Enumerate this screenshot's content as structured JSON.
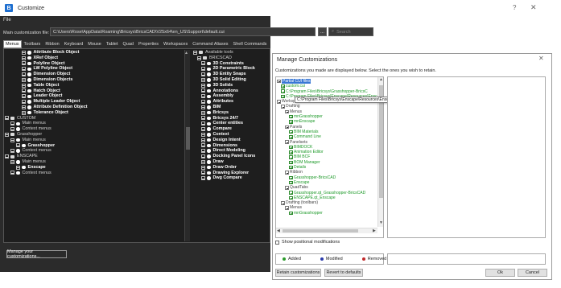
{
  "customize": {
    "title": "Customize",
    "app_icon": "bricscad-logo-icon",
    "help_label": "?",
    "close_label": "✕",
    "menubar": "File",
    "main_file_label": "Main customization file:",
    "main_file_value": "C:\\Users\\Rose\\AppData\\Roaming\\Bricsys\\BricsCAD\\V25x64\\en_US\\Support\\default.cui",
    "browse_label": "...",
    "search_placeholder": "Search",
    "tabs": [
      "Menus",
      "Toolbars",
      "Ribbon",
      "Keyboard",
      "Mouse",
      "Tablet",
      "Quad",
      "Properties",
      "Workspaces",
      "Command Aliases",
      "Shell Commands"
    ],
    "active_tab": "Menus",
    "left_tree": [
      {
        "label": "Attribute Block Object",
        "bold": true
      },
      {
        "label": "XRef Object",
        "bold": true
      },
      {
        "label": "Polyline Object",
        "bold": true
      },
      {
        "label": "LW Polyline Object",
        "bold": true
      },
      {
        "label": "Dimension Object",
        "bold": true
      },
      {
        "label": "Dimension Objects",
        "bold": true
      },
      {
        "label": "Table Object",
        "bold": true
      },
      {
        "label": "Hatch Object",
        "bold": true
      },
      {
        "label": "Leader Object",
        "bold": true
      },
      {
        "label": "Multiple Leader Object",
        "bold": true
      },
      {
        "label": "Attribute Definition Object",
        "bold": true
      },
      {
        "label": "Tolerance Object",
        "bold": true
      },
      {
        "label": "CUSTOM",
        "bold": false
      },
      {
        "label": "Main menus",
        "bold": false
      },
      {
        "label": "Context menus",
        "bold": false
      },
      {
        "label": "Grasshopper",
        "bold": false
      },
      {
        "label": "Main menus",
        "bold": false
      },
      {
        "label": "Grasshopper",
        "bold": true
      },
      {
        "label": "Context menus",
        "bold": false
      },
      {
        "label": "ENSCAPE",
        "bold": false
      },
      {
        "label": "Main menus",
        "bold": false
      },
      {
        "label": "Enscape",
        "bold": true
      },
      {
        "label": "Context menus",
        "bold": false
      }
    ],
    "right_tree": [
      {
        "label": "Available tools",
        "bold": false
      },
      {
        "label": "BRICSCAD",
        "bold": false
      },
      {
        "label": "3D Constraints",
        "bold": true
      },
      {
        "label": "2D Parametric Block",
        "bold": true
      },
      {
        "label": "3D Entity Snaps",
        "bold": true
      },
      {
        "label": "3D Solid Editing",
        "bold": true
      },
      {
        "label": "3D Solids",
        "bold": true
      },
      {
        "label": "Annotations",
        "bold": true
      },
      {
        "label": "Assembly",
        "bold": true
      },
      {
        "label": "Attributes",
        "bold": true
      },
      {
        "label": "BIM",
        "bold": true
      },
      {
        "label": "Bricsys",
        "bold": true
      },
      {
        "label": "Bricsys 24/7",
        "bold": true
      },
      {
        "label": "Center entities",
        "bold": true
      },
      {
        "label": "Compare",
        "bold": true
      },
      {
        "label": "Context",
        "bold": true
      },
      {
        "label": "Design Intent",
        "bold": true
      },
      {
        "label": "Dimensions",
        "bold": true
      },
      {
        "label": "Direct Modeling",
        "bold": true
      },
      {
        "label": "Docking Panel Icons",
        "bold": true
      },
      {
        "label": "Draw",
        "bold": true
      },
      {
        "label": "Draw Order",
        "bold": true
      },
      {
        "label": "Drawing Explorer",
        "bold": true
      },
      {
        "label": "Dwg Compare",
        "bold": true
      }
    ],
    "manage_button": "Manage your customizations..."
  },
  "dialog": {
    "title": "Manage Customizations",
    "close_label": "✕",
    "description": "Customizations you made are displayed below. Select the ones you wish to retain.",
    "tree": [
      {
        "label": "Partial CUI files",
        "indent": 0,
        "kind": "mx",
        "color": "sel"
      },
      {
        "label": "custom.cui",
        "indent": 1,
        "kind": "cb",
        "color": "green"
      },
      {
        "label": "C:\\Program Files\\Bricsys\\Grasshopper-BricsC",
        "indent": 1,
        "kind": "cb",
        "color": "green"
      },
      {
        "label": "C:\\Program Files\\Bricsys\\Enscape\\Resources\\Enscape.cui",
        "indent": 1,
        "kind": "cb",
        "color": "green"
      },
      {
        "label": "Workspaces",
        "indent": 0,
        "kind": "mx",
        "color": "dark"
      },
      {
        "label": "Drafting",
        "indent": 1,
        "kind": "mx",
        "color": "dark"
      },
      {
        "label": "Menus",
        "indent": 2,
        "kind": "mx",
        "color": "dark"
      },
      {
        "label": "mnGrasshopper",
        "indent": 3,
        "kind": "cb",
        "color": "green"
      },
      {
        "label": "mnEnscape",
        "indent": 3,
        "kind": "cb",
        "color": "green"
      },
      {
        "label": "Panels",
        "indent": 2,
        "kind": "mx",
        "color": "dark"
      },
      {
        "label": "BIM Materials",
        "indent": 3,
        "kind": "cb",
        "color": "green"
      },
      {
        "label": "Command Line",
        "indent": 3,
        "kind": "cb",
        "color": "green"
      },
      {
        "label": "Panelsets",
        "indent": 2,
        "kind": "mx",
        "color": "dark"
      },
      {
        "label": "BIMDOCK",
        "indent": 3,
        "kind": "cb",
        "color": "green"
      },
      {
        "label": "Animation Editor",
        "indent": 3,
        "kind": "cb",
        "color": "green"
      },
      {
        "label": "BIM BCF",
        "indent": 3,
        "kind": "cb",
        "color": "green"
      },
      {
        "label": "BOM Manager",
        "indent": 3,
        "kind": "cb",
        "color": "green"
      },
      {
        "label": "Details",
        "indent": 3,
        "kind": "cb",
        "color": "green"
      },
      {
        "label": "Ribbon",
        "indent": 2,
        "kind": "mx",
        "color": "dark"
      },
      {
        "label": "Grasshopper-BricsCAD",
        "indent": 3,
        "kind": "cb",
        "color": "green"
      },
      {
        "label": "Enscape",
        "indent": 3,
        "kind": "cb",
        "color": "green"
      },
      {
        "label": "QuadTabs",
        "indent": 2,
        "kind": "mx",
        "color": "dark"
      },
      {
        "label": "Grasshopper.qt_Grasshopper-BricsCAD",
        "indent": 3,
        "kind": "cb",
        "color": "green"
      },
      {
        "label": "ENSCAPE.qt_Enscape",
        "indent": 3,
        "kind": "cb",
        "color": "green"
      },
      {
        "label": "Drafting (toolbars)",
        "indent": 1,
        "kind": "mx",
        "color": "dark"
      },
      {
        "label": "Menus",
        "indent": 2,
        "kind": "mx",
        "color": "dark"
      },
      {
        "label": "mnGrasshopper",
        "indent": 3,
        "kind": "cb",
        "color": "green"
      }
    ],
    "tooltip": "C:\\Program Files\\Bricsys\\Enscape\\Resources\\Enscape.cui",
    "show_positional": "Show positional modifications",
    "legend": [
      {
        "label": "Added",
        "color": "#2a9a2a"
      },
      {
        "label": "Modified",
        "color": "#2a3aaa"
      },
      {
        "label": "Removed",
        "color": "#c0282a"
      }
    ],
    "retain_button": "Retain customizations",
    "revert_button": "Revert to defaults",
    "ok_button": "Ok",
    "cancel_button": "Cancel"
  }
}
